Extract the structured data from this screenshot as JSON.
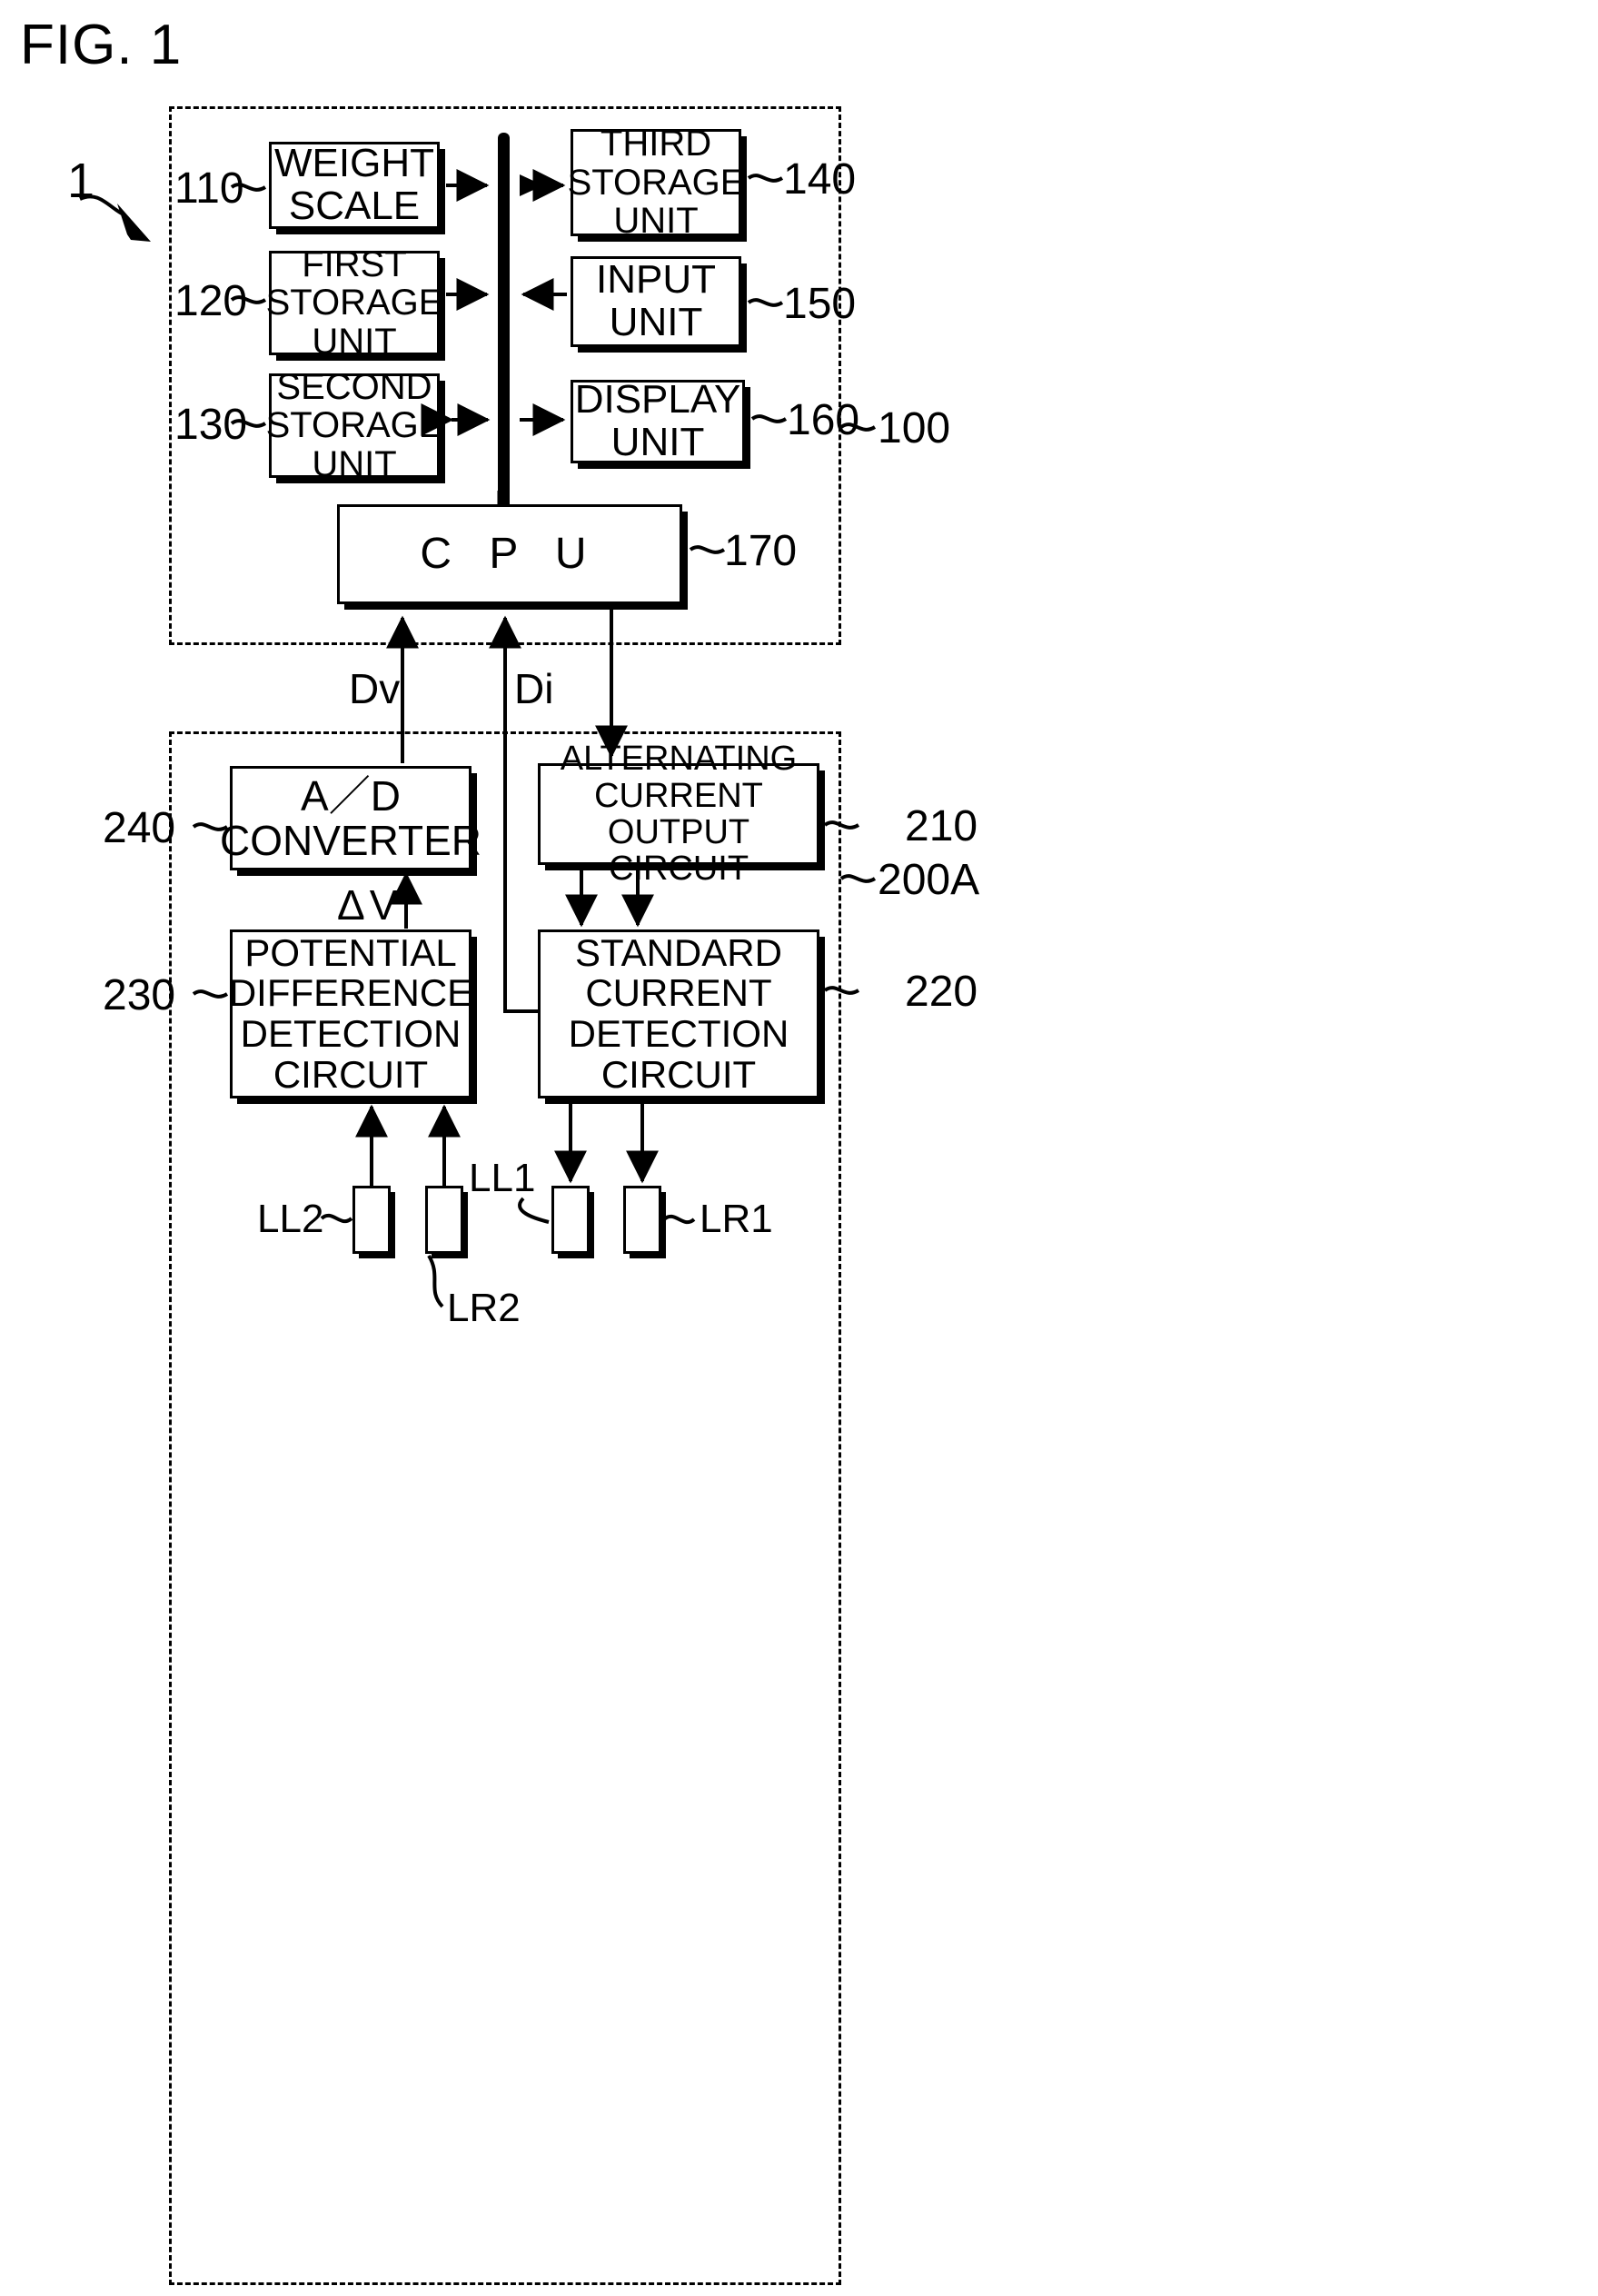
{
  "figure": {
    "title": "FIG. 1",
    "system_ref": "1"
  },
  "enclosures": [
    {
      "name": "measurement-body-unit",
      "ref": "100"
    },
    {
      "name": "measurement-circuit-unit",
      "ref": "200A"
    }
  ],
  "upper_unit": {
    "ref": "100",
    "bus_name": "cpu-bus",
    "left_blocks": [
      {
        "ref": "110",
        "lines": [
          "WEIGHT",
          "SCALE"
        ],
        "arrow": "to-bus"
      },
      {
        "ref": "120",
        "lines": [
          "FIRST",
          "STORAGE",
          "UNIT"
        ],
        "arrow": "to-bus"
      },
      {
        "ref": "130",
        "lines": [
          "SECOND",
          "STORAGE",
          "UNIT"
        ],
        "arrow": "bidirectional"
      }
    ],
    "right_blocks": [
      {
        "ref": "140",
        "lines": [
          "THIRD",
          "STORAGE",
          "UNIT"
        ],
        "arrow": "bidirectional"
      },
      {
        "ref": "150",
        "lines": [
          "INPUT",
          "UNIT"
        ],
        "arrow": "to-bus"
      },
      {
        "ref": "160",
        "lines": [
          "DISPLAY",
          "UNIT"
        ],
        "arrow": "from-bus"
      }
    ],
    "cpu": {
      "ref": "170",
      "label": "C P U"
    }
  },
  "signals": {
    "dv": "Dv",
    "di": "Di",
    "delta_v": "ΔV"
  },
  "lower_unit": {
    "ref": "200A",
    "blocks": [
      {
        "ref": "240",
        "lines": [
          "A／D",
          "CONVERTER"
        ]
      },
      {
        "ref": "210",
        "lines": [
          "ALTERNATING",
          "CURRENT OUTPUT",
          "CIRCUIT"
        ]
      },
      {
        "ref": "230",
        "lines": [
          "POTENTIAL",
          "DIFFERENCE",
          "DETECTION",
          "CIRCUIT"
        ]
      },
      {
        "ref": "220",
        "lines": [
          "STANDARD",
          "CURRENT",
          "DETECTION",
          "CIRCUIT"
        ]
      }
    ],
    "electrodes": [
      {
        "label": "LL2",
        "name": "electrode-ll2"
      },
      {
        "label": "LR2",
        "name": "electrode-lr2"
      },
      {
        "label": "LL1",
        "name": "electrode-ll1"
      },
      {
        "label": "LR1",
        "name": "electrode-lr1"
      }
    ]
  }
}
